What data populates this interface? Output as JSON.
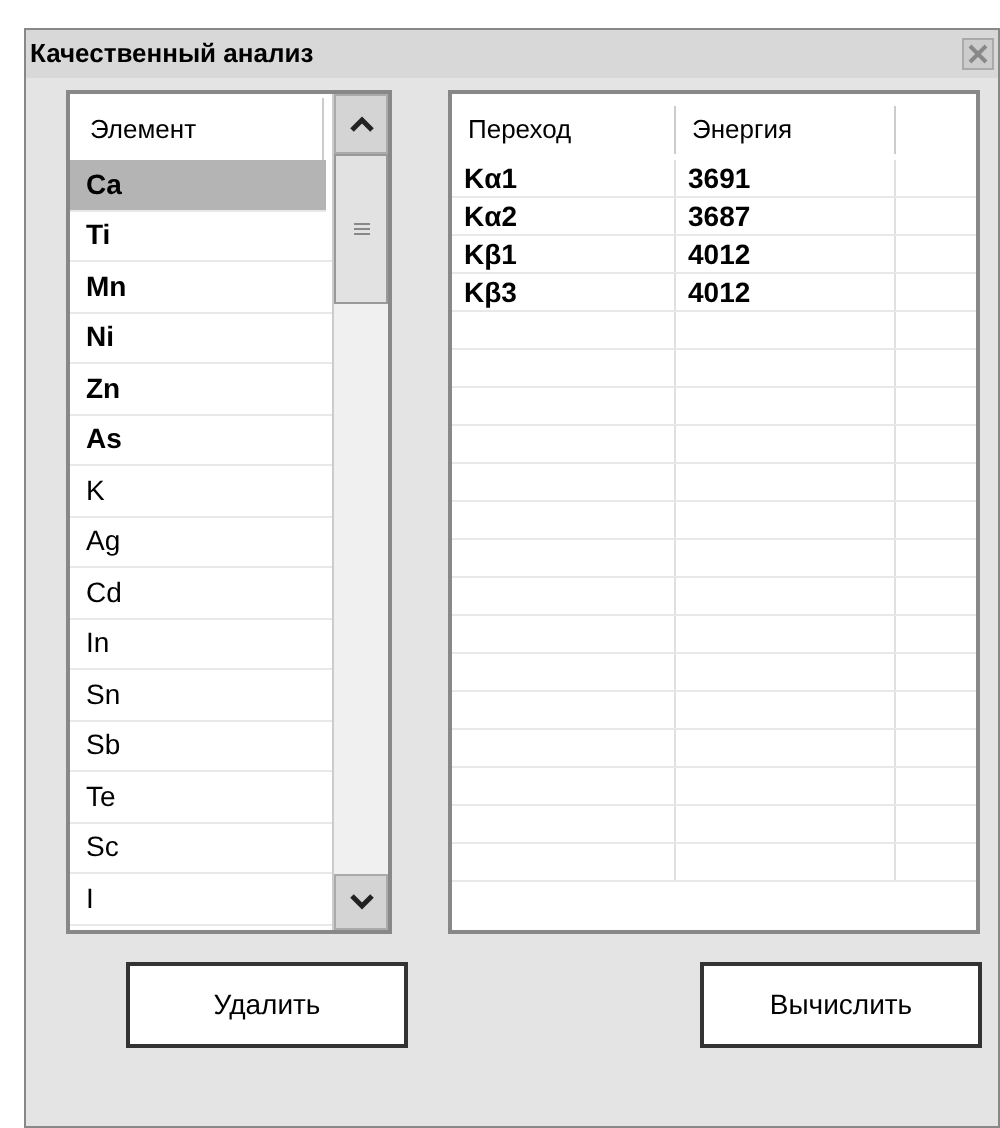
{
  "window": {
    "title": "Качественный анализ"
  },
  "elements": {
    "header": "Элемент",
    "items": [
      {
        "symbol": "Ca",
        "bold": true,
        "selected": true
      },
      {
        "symbol": "Ti",
        "bold": true,
        "selected": false
      },
      {
        "symbol": "Mn",
        "bold": true,
        "selected": false
      },
      {
        "symbol": "Ni",
        "bold": true,
        "selected": false
      },
      {
        "symbol": "Zn",
        "bold": true,
        "selected": false
      },
      {
        "symbol": "As",
        "bold": true,
        "selected": false
      },
      {
        "symbol": "K",
        "bold": false,
        "selected": false
      },
      {
        "symbol": "Ag",
        "bold": false,
        "selected": false
      },
      {
        "symbol": "Cd",
        "bold": false,
        "selected": false
      },
      {
        "symbol": "In",
        "bold": false,
        "selected": false
      },
      {
        "symbol": "Sn",
        "bold": false,
        "selected": false
      },
      {
        "symbol": "Sb",
        "bold": false,
        "selected": false
      },
      {
        "symbol": "Te",
        "bold": false,
        "selected": false
      },
      {
        "symbol": "Sc",
        "bold": false,
        "selected": false
      },
      {
        "symbol": "I",
        "bold": false,
        "selected": false
      }
    ]
  },
  "lines": {
    "columns": [
      "Переход",
      "Энергия"
    ],
    "rows": [
      [
        "Kα1",
        "3691"
      ],
      [
        "Kα2",
        "3687"
      ],
      [
        "Kβ1",
        "4012"
      ],
      [
        "Kβ3",
        "4012"
      ]
    ]
  },
  "buttons": [
    "Удалить",
    "Вычислить"
  ]
}
